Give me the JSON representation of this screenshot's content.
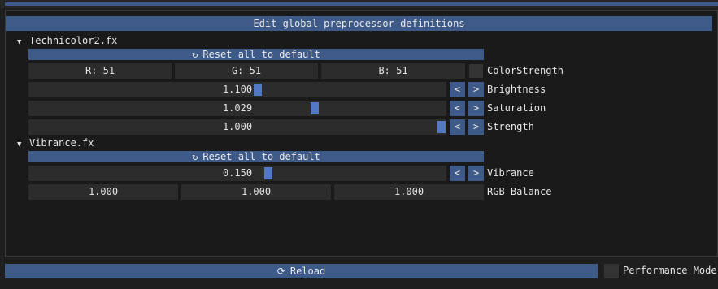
{
  "header": {
    "edit_button_label": "Edit global preprocessor definitions"
  },
  "technicolor": {
    "title": "Technicolor2.fx",
    "reset_label": "Reset all to default",
    "color_r": "R: 51",
    "color_g": "G: 51",
    "color_b": "B: 51",
    "color_strength_label": "ColorStrength",
    "brightness": {
      "value": "1.100",
      "label": "Brightness",
      "fraction": 0.55
    },
    "saturation": {
      "value": "1.029",
      "label": "Saturation",
      "fraction": 0.69
    },
    "strength": {
      "value": "1.000",
      "label": "Strength",
      "fraction": 1.0
    }
  },
  "vibrance": {
    "title": "Vibrance.fx",
    "reset_label": "Reset all to default",
    "vibrance": {
      "value": "0.150",
      "label": "Vibrance",
      "fraction": 0.575
    },
    "rgb_balance": {
      "r": "1.000",
      "g": "1.000",
      "b": "1.000",
      "label": "RGB Balance"
    }
  },
  "buttons": {
    "decrement": "<",
    "increment": ">"
  },
  "footer": {
    "reload_label": "Reload",
    "performance_mode_label": "Performance Mode"
  },
  "icons": {
    "expanded": "▼",
    "reset": "↻",
    "reload": "⟳"
  },
  "colors": {
    "accent": "#3e5a88",
    "grab": "#5278c6",
    "field": "#2c2c2c"
  }
}
